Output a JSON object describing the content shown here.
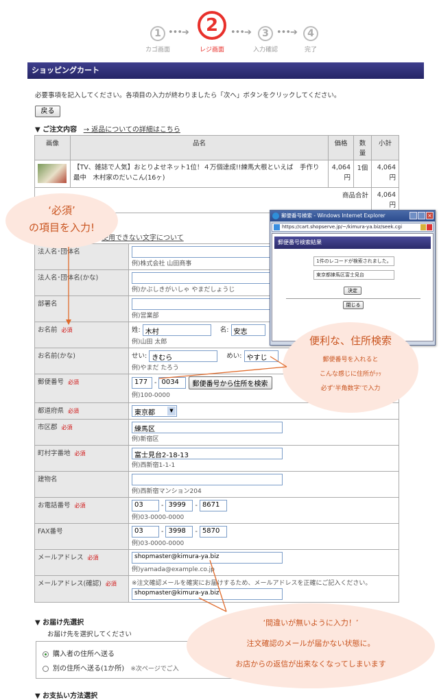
{
  "steps": [
    {
      "num": "1",
      "label": "カゴ画面"
    },
    {
      "num": "2",
      "label": "レジ画面"
    },
    {
      "num": "3",
      "label": "入力確認"
    },
    {
      "num": "4",
      "label": "完了"
    }
  ],
  "cart_title": "ショッピングカート",
  "instruction": "必要事項を記入してください。各項目の入力が終わりましたら「次へ」ボタンをクリックしてください。",
  "back_button": "戻る",
  "order_section": {
    "title": "▼ ご注文内容",
    "link": "→ 返品についての詳細はこちら"
  },
  "order_table": {
    "headers": [
      "画像",
      "品名",
      "価格",
      "数量",
      "小計"
    ],
    "item_name": "【TV、雑誌で人気】おとりよせネット1位！４万個達成!!練馬大根といえば　手作り最中　木村家のだいこん(16ヶ)",
    "price": "4,064円",
    "qty": "1個",
    "subtotal": "4,064円",
    "total_label": "商品合計",
    "total": "4,064円"
  },
  "unusable_link": "使用できない文字について",
  "fields": {
    "corp": {
      "label": "法人名･団体名",
      "example": "例)株式会社 山田商事"
    },
    "corp_kana": {
      "label": "法人名･団体名(かな)",
      "example": "例)かぶしきがいしゃ やまだしょうじ"
    },
    "dept": {
      "label": "部署名",
      "example": "例)営業部"
    },
    "name": {
      "label": "お名前",
      "sei_label": "姓:",
      "sei": "木村",
      "mei_label": "名:",
      "mei": "安志",
      "example": "例)山田 太郎"
    },
    "name_kana": {
      "label": "お名前(かな)",
      "sei_label": "せい:",
      "sei": "きむら",
      "mei_label": "めい:",
      "mei": "やすじ",
      "example": "例)やまだ たろう"
    },
    "zip": {
      "label": "郵便番号",
      "zip1": "177",
      "zip2": "0034",
      "search_button": "郵便番号から住所を検索",
      "example": "例)100-0000"
    },
    "pref": {
      "label": "都道府県",
      "value": "東京都"
    },
    "city": {
      "label": "市区郡",
      "value": "練馬区",
      "example": "例)新宿区"
    },
    "town": {
      "label": "町村字番地",
      "value": "富士見台2-18-13",
      "example": "例)西新宿1-1-1"
    },
    "building": {
      "label": "建物名",
      "value": "",
      "example": "例)西新宿マンション204"
    },
    "tel": {
      "label": "お電話番号",
      "p1": "03",
      "p2": "3999",
      "p3": "8671",
      "example": "例)03-0000-0000"
    },
    "fax": {
      "label": "FAX番号",
      "p1": "03",
      "p2": "3998",
      "p3": "5870",
      "example": "例)03-0000-0000"
    },
    "email": {
      "label": "メールアドレス",
      "value": "shopmaster@kimura-ya.biz",
      "example": "例)yamada@example.co.jp"
    },
    "email_confirm": {
      "label": "メールアドレス(確認)",
      "note": "※注文確認メールを確実にお届けするため、メールアドレスを正確にご記入ください。",
      "value": "shopmaster@kimura-ya.biz"
    }
  },
  "required_mark": "必須",
  "delivery": {
    "title": "▼ お届け先選択",
    "subtitle": "お届け先を選択してください",
    "option1": "購入者の住所へ送る",
    "option2": "別の住所へ送る(1か所)",
    "option2_note": "※次ページでご入"
  },
  "payment": {
    "title": "▼ お支払い方法選択"
  },
  "popup": {
    "title": "郵便番号検索 - Windows Internet Explorer",
    "url": "https://cart.shopserve.jp/~/kimura-ya.biz/seek.cgi",
    "header": "郵便番号検索結果",
    "result": "1件のレコードが検索されました。",
    "address": "東京都練馬区富士見台",
    "decide_button": "決定",
    "close_button": "閉じる"
  },
  "bubbles": {
    "required": {
      "line1": "‘必須’",
      "line2": "の項目を入力!"
    },
    "address": {
      "line1": "便利な、住所検索",
      "line2": "郵便番号を入れると",
      "line3": "こんな感じに住所がｯｯ",
      "line4": "必ず‘半角数字’で入力"
    },
    "email": {
      "line1": "‘間違いが無いように入力！’",
      "line2": "注文確認のメールが届かない状態に。",
      "line3": "お店からの返信が出来なくなってしまいます"
    }
  }
}
